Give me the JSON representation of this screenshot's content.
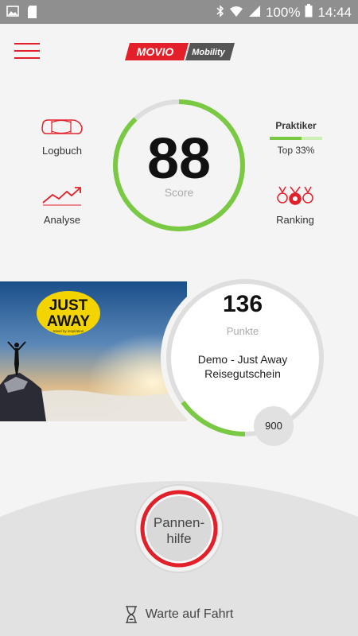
{
  "status_bar": {
    "battery": "100%",
    "time": "14:44"
  },
  "header": {
    "logo_text": "MOVIO",
    "logo_sub": "Mobility"
  },
  "nav": {
    "logbook": "Logbuch",
    "analysis": "Analyse",
    "ranking": "Ranking"
  },
  "score": {
    "value": "88",
    "label": "Score",
    "progress": 0.88
  },
  "level": {
    "title": "Praktiker",
    "subtitle": "Top 33%",
    "progress": 0.6
  },
  "promo": {
    "brand_line1": "JUST",
    "brand_line2": "AWAY",
    "brand_tagline": "travel by inspiration"
  },
  "points": {
    "value": "136",
    "label": "Punkte",
    "voucher_line1": "Demo - Just Away",
    "voucher_line2": "Reisegutschein",
    "goal": "900",
    "progress": 0.151
  },
  "breakdown": {
    "line1": "Pannen-",
    "line2": "hilfe"
  },
  "status": {
    "waiting": "Warte auf Fahrt"
  },
  "colors": {
    "brand_red": "#e3202a",
    "accent_green": "#7ac943",
    "ring_gray": "#dedede"
  }
}
